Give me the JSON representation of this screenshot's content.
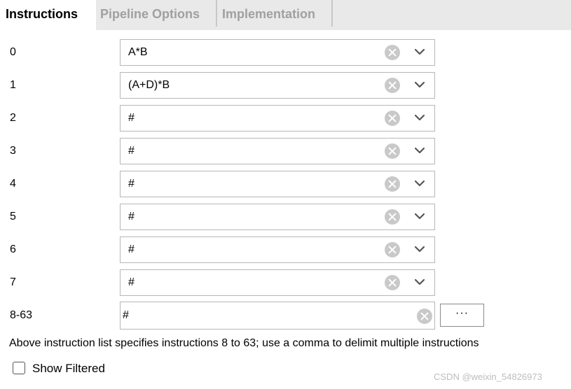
{
  "tabs": [
    {
      "label": "Instructions",
      "active": true
    },
    {
      "label": "Pipeline Options",
      "active": false
    },
    {
      "label": "Implementation",
      "active": false
    }
  ],
  "instruction_rows": [
    {
      "label": "0",
      "value": "A*B"
    },
    {
      "label": "1",
      "value": "(A+D)*B"
    },
    {
      "label": "2",
      "value": "#"
    },
    {
      "label": "3",
      "value": "#"
    },
    {
      "label": "4",
      "value": "#"
    },
    {
      "label": "5",
      "value": "#"
    },
    {
      "label": "6",
      "value": "#"
    },
    {
      "label": "7",
      "value": "#"
    }
  ],
  "extended_row": {
    "label": "8-63",
    "value": "#",
    "button_label": "···"
  },
  "info_text": "Above instruction list specifies instructions 8 to 63; use a comma to delimit multiple instructions",
  "show_filtered": {
    "label": "Show Filtered",
    "checked": false
  },
  "watermark": "CSDN @weixin_54826973",
  "colors": {
    "tab_bar_bg": "#e9e9e9",
    "inactive_tab_text": "#a0a0a0",
    "clear_icon": "#c9c9c9",
    "field_border": "#b7b7b7"
  }
}
